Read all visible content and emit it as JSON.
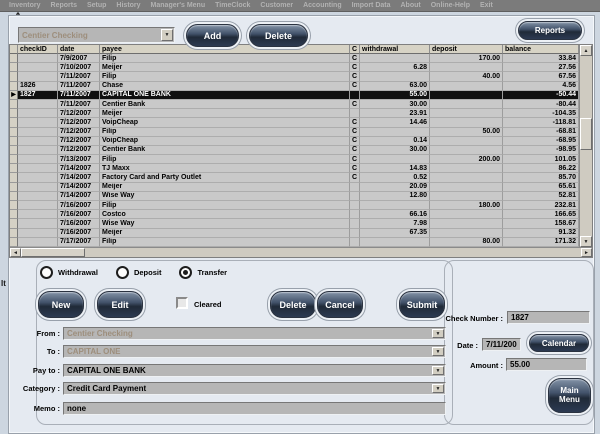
{
  "icons": {
    "dropdown_arrow": "▼",
    "scroll_up": "▲",
    "scroll_down": "▼",
    "scroll_left": "◄",
    "scroll_right": "►",
    "row_pointer": "▶",
    "checkbox_check": "✓"
  },
  "menu_bar": {
    "items": [
      "Inventory",
      "Reports",
      "Setup",
      "History",
      "Manager's Menu",
      "TimeClock",
      "Customer",
      "Accounting",
      "Import Data",
      "About",
      "Online-Help",
      "Exit"
    ]
  },
  "background_window": {
    "title_fragment": "A",
    "left_fragment": "It"
  },
  "toolbar": {
    "account_value": "Centier Checking",
    "add": "Add",
    "delete": "Delete",
    "reports": "Reports"
  },
  "table": {
    "columns": [
      "checkID",
      "date",
      "payee",
      "C",
      "withdrawal",
      "deposit",
      "balance"
    ],
    "rows": [
      {
        "check_id": "",
        "date": "7/9/2007",
        "payee": "Filip",
        "c": "C",
        "withdrawal": "",
        "deposit": "170.00",
        "balance": "33.84",
        "selected": false
      },
      {
        "check_id": "",
        "date": "7/10/2007",
        "payee": "Meijer",
        "c": "C",
        "withdrawal": "6.28",
        "deposit": "",
        "balance": "27.56",
        "selected": false
      },
      {
        "check_id": "",
        "date": "7/11/2007",
        "payee": "Filip",
        "c": "C",
        "withdrawal": "",
        "deposit": "40.00",
        "balance": "67.56",
        "selected": false
      },
      {
        "check_id": "1826",
        "date": "7/11/2007",
        "payee": "Chase",
        "c": "C",
        "withdrawal": "63.00",
        "deposit": "",
        "balance": "4.56",
        "selected": false
      },
      {
        "check_id": "1827",
        "date": "7/11/2007",
        "payee": "CAPITAL ONE BANK",
        "c": "",
        "withdrawal": "55.00",
        "deposit": "",
        "balance": "-50.44",
        "selected": true
      },
      {
        "check_id": "",
        "date": "7/11/2007",
        "payee": "Centier Bank",
        "c": "C",
        "withdrawal": "30.00",
        "deposit": "",
        "balance": "-80.44",
        "selected": false
      },
      {
        "check_id": "",
        "date": "7/12/2007",
        "payee": "Meijer",
        "c": "",
        "withdrawal": "23.91",
        "deposit": "",
        "balance": "-104.35",
        "selected": false
      },
      {
        "check_id": "",
        "date": "7/12/2007",
        "payee": "VoipCheap",
        "c": "C",
        "withdrawal": "14.46",
        "deposit": "",
        "balance": "-118.81",
        "selected": false
      },
      {
        "check_id": "",
        "date": "7/12/2007",
        "payee": "Filip",
        "c": "C",
        "withdrawal": "",
        "deposit": "50.00",
        "balance": "-68.81",
        "selected": false
      },
      {
        "check_id": "",
        "date": "7/12/2007",
        "payee": "VoipCheap",
        "c": "C",
        "withdrawal": "0.14",
        "deposit": "",
        "balance": "-68.95",
        "selected": false
      },
      {
        "check_id": "",
        "date": "7/12/2007",
        "payee": "Centier Bank",
        "c": "C",
        "withdrawal": "30.00",
        "deposit": "",
        "balance": "-98.95",
        "selected": false
      },
      {
        "check_id": "",
        "date": "7/13/2007",
        "payee": "Filip",
        "c": "C",
        "withdrawal": "",
        "deposit": "200.00",
        "balance": "101.05",
        "selected": false
      },
      {
        "check_id": "",
        "date": "7/14/2007",
        "payee": "TJ Maxx",
        "c": "C",
        "withdrawal": "14.83",
        "deposit": "",
        "balance": "86.22",
        "selected": false
      },
      {
        "check_id": "",
        "date": "7/14/2007",
        "payee": "Factory Card and Party Outlet",
        "c": "C",
        "withdrawal": "0.52",
        "deposit": "",
        "balance": "85.70",
        "selected": false
      },
      {
        "check_id": "",
        "date": "7/14/2007",
        "payee": "Meijer",
        "c": "",
        "withdrawal": "20.09",
        "deposit": "",
        "balance": "65.61",
        "selected": false
      },
      {
        "check_id": "",
        "date": "7/14/2007",
        "payee": "Wise Way",
        "c": "",
        "withdrawal": "12.80",
        "deposit": "",
        "balance": "52.81",
        "selected": false
      },
      {
        "check_id": "",
        "date": "7/16/2007",
        "payee": "Filip",
        "c": "",
        "withdrawal": "",
        "deposit": "180.00",
        "balance": "232.81",
        "selected": false
      },
      {
        "check_id": "",
        "date": "7/16/2007",
        "payee": "Costco",
        "c": "",
        "withdrawal": "66.16",
        "deposit": "",
        "balance": "166.65",
        "selected": false
      },
      {
        "check_id": "",
        "date": "7/16/2007",
        "payee": "Wise Way",
        "c": "",
        "withdrawal": "7.98",
        "deposit": "",
        "balance": "158.67",
        "selected": false
      },
      {
        "check_id": "",
        "date": "7/16/2007",
        "payee": "Meijer",
        "c": "",
        "withdrawal": "67.35",
        "deposit": "",
        "balance": "91.32",
        "selected": false
      },
      {
        "check_id": "",
        "date": "7/17/2007",
        "payee": "Filip",
        "c": "",
        "withdrawal": "",
        "deposit": "80.00",
        "balance": "171.32",
        "selected": false
      }
    ]
  },
  "transaction_form": {
    "type_options": [
      {
        "label": "Withdrawal",
        "selected": false
      },
      {
        "label": "Deposit",
        "selected": false
      },
      {
        "label": "Transfer",
        "selected": true
      }
    ],
    "new": "New",
    "edit": "Edit",
    "cleared_label": "Cleared",
    "cleared_checked": false,
    "delete": "Delete",
    "cancel": "Cancel",
    "submit": "Submit",
    "fields": [
      {
        "label": "From :",
        "value": "Centier Checking",
        "disabled": true,
        "combo": true
      },
      {
        "label": "To :",
        "value": "CAPITAL ONE",
        "disabled": true,
        "combo": true
      },
      {
        "label": "Pay to :",
        "value": "CAPITAL ONE BANK",
        "disabled": false,
        "combo": true
      },
      {
        "label": "Category :",
        "value": "Credit Card Payment",
        "disabled": false,
        "combo": true
      },
      {
        "label": "Memo :",
        "value": "none",
        "disabled": false,
        "combo": false
      }
    ]
  },
  "details_panel": {
    "check_number_label": "Check Number :",
    "check_number": "1827",
    "date_label": "Date :",
    "date": "7/11/200",
    "calendar": "Calendar",
    "amount_label": "Amount :",
    "amount": "55.00",
    "main_menu": "Main Menu"
  }
}
